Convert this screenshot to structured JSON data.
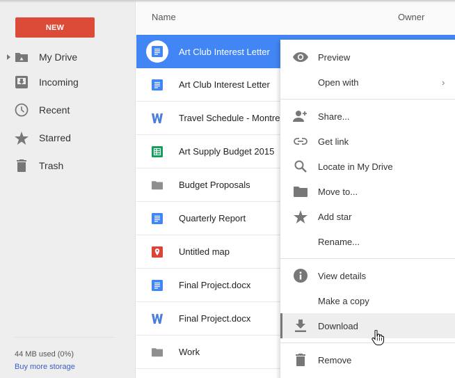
{
  "sidebar": {
    "new_label": "NEW",
    "items": [
      {
        "label": "My Drive",
        "icon": "drive-folder-icon",
        "expandable": true
      },
      {
        "label": "Incoming",
        "icon": "incoming-icon"
      },
      {
        "label": "Recent",
        "icon": "clock-icon"
      },
      {
        "label": "Starred",
        "icon": "star-icon"
      },
      {
        "label": "Trash",
        "icon": "trash-icon"
      }
    ],
    "storage_used": "44 MB used (0%)",
    "storage_link": "Buy more storage"
  },
  "file_list": {
    "columns": {
      "name": "Name",
      "owner": "Owner"
    },
    "rows": [
      {
        "name": "Art Club Interest Letter",
        "type": "google-doc",
        "selected": true
      },
      {
        "name": "Art Club Interest Letter",
        "type": "google-doc"
      },
      {
        "name": "Travel Schedule - Montre",
        "type": "word"
      },
      {
        "name": "Art Supply Budget 2015",
        "type": "google-sheet"
      },
      {
        "name": "Budget Proposals",
        "type": "folder"
      },
      {
        "name": "Quarterly Report",
        "type": "google-doc"
      },
      {
        "name": "Untitled map",
        "type": "google-map"
      },
      {
        "name": "Final Project.docx",
        "type": "google-doc"
      },
      {
        "name": "Final Project.docx",
        "type": "word"
      },
      {
        "name": "Work",
        "type": "folder"
      }
    ]
  },
  "context_menu": {
    "items": [
      {
        "label": "Preview",
        "icon": "eye-icon"
      },
      {
        "label": "Open with",
        "icon": "",
        "submenu": true
      },
      {
        "label": "Share...",
        "icon": "add-person-icon"
      },
      {
        "label": "Get link",
        "icon": "link-icon"
      },
      {
        "label": "Locate in My Drive",
        "icon": "search-icon"
      },
      {
        "label": "Move to...",
        "icon": "folder-icon"
      },
      {
        "label": "Add star",
        "icon": "star-icon"
      },
      {
        "label": "Rename...",
        "icon": ""
      },
      {
        "label": "View details",
        "icon": "info-icon"
      },
      {
        "label": "Make a copy",
        "icon": ""
      },
      {
        "label": "Download",
        "icon": "download-icon",
        "hovered": true
      },
      {
        "label": "Remove",
        "icon": "trash-icon"
      }
    ],
    "submenu_glyph": "›"
  },
  "colors": {
    "new_button": "#dc4a38",
    "selection": "#4285f4",
    "doc_blue": "#4285f4",
    "sheet_green": "#0f9d58",
    "map_red": "#db4437",
    "icon_gray": "#777777"
  }
}
